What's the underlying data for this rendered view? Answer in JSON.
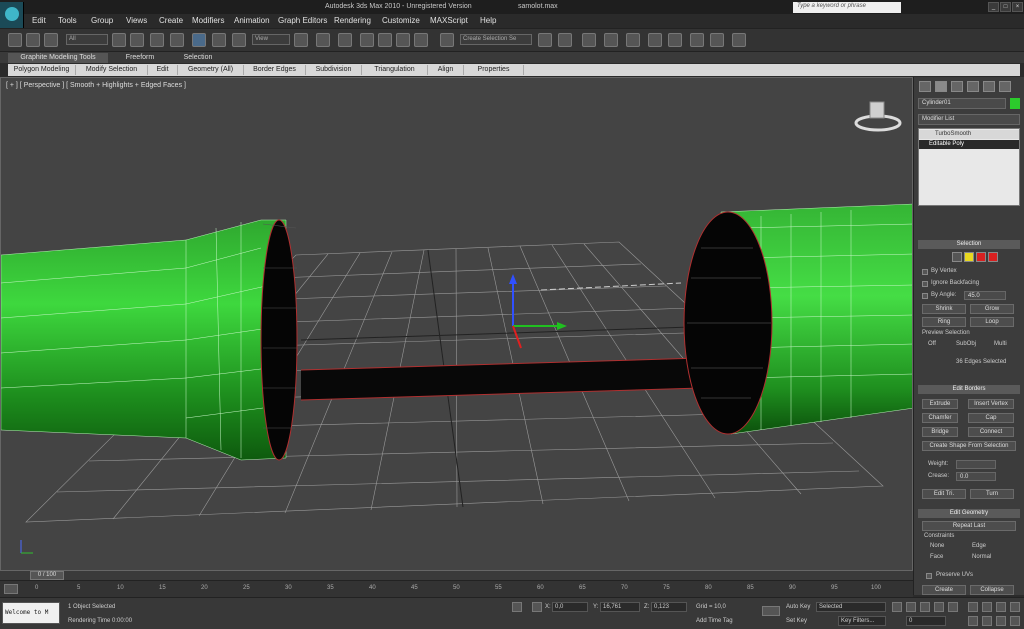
{
  "app": {
    "title": "Autodesk 3ds Max  2010  - Unregistered Version",
    "filename": "samolot.max",
    "search_placeholder": "Type a keyword or phrase"
  },
  "menu": [
    "Edit",
    "Tools",
    "Group",
    "Views",
    "Create",
    "Modifiers",
    "Animation",
    "Graph Editors",
    "Rendering",
    "Customize",
    "MAXScript",
    "Help"
  ],
  "toolbar": {
    "selection_filter": "All",
    "reference_coord": "View",
    "named_selection": "Create Selection Se"
  },
  "ribbon": {
    "tabs": [
      "Graphite Modeling Tools",
      "Freeform",
      "Selection"
    ],
    "active_tab": "Graphite Modeling Tools",
    "panels": [
      "Polygon Modeling",
      "Modify Selection",
      "Edit",
      "Geometry (All)",
      "Border Edges",
      "Subdivision",
      "Triangulation",
      "Align",
      "Properties"
    ]
  },
  "viewport": {
    "label": "[ + ] [ Perspective ] [ Smooth + Highlights + Edged Faces ]"
  },
  "command_panel": {
    "object_name": "Cylinder01",
    "modifier_list": "Modifier List",
    "stack": [
      "TurboSmooth",
      "Editable Poly"
    ],
    "selection": {
      "title": "Selection",
      "by_vertex": "By Vertex",
      "ignore_backfacing": "Ignore Backfacing",
      "by_angle": "By Angle:",
      "by_angle_value": "45.0",
      "shrink": "Shrink",
      "grow": "Grow",
      "ring": "Ring",
      "loop": "Loop",
      "preview_selection": "Preview Selection",
      "off": "Off",
      "subobj": "SubObj",
      "multi": "Multi",
      "status": "36 Edges Selected"
    },
    "edit_borders": {
      "title": "Edit Borders",
      "extrude": "Extrude",
      "insert_vertex": "Insert Vertex",
      "chamfer": "Chamfer",
      "cap": "Cap",
      "bridge": "Bridge",
      "connect": "Connect",
      "create_shape": "Create Shape From Selection",
      "weight": "Weight:",
      "crease": "Crease:",
      "crease_value": "0.0",
      "edit_tri": "Edit Tri.",
      "turn": "Turn"
    },
    "edit_geometry": {
      "title": "Edit Geometry",
      "repeat_last": "Repeat Last",
      "constraints": "Constraints",
      "none": "None",
      "edge": "Edge",
      "face": "Face",
      "normal": "Normal",
      "preserve_uvs": "Preserve UVs",
      "create": "Create",
      "collapse": "Collapse"
    }
  },
  "timeline": {
    "frame": "0 / 100",
    "ticks": [
      "0",
      "5",
      "10",
      "15",
      "20",
      "25",
      "30",
      "35",
      "40",
      "45",
      "50",
      "55",
      "60",
      "65",
      "70",
      "75",
      "80",
      "85",
      "90",
      "95",
      "100"
    ]
  },
  "status": {
    "welcome": "Welcome to M",
    "selected": "1 Object Selected",
    "rendering_time": "Rendering Time  0:00:00",
    "x": "0,0",
    "y": "16,761",
    "z": "0,123",
    "grid": "Grid = 10,0",
    "add_time_tag": "Add Time Tag",
    "auto_key": "Auto Key",
    "set_key": "Set Key",
    "key_mode": "Selected",
    "key_filters": "Key Filters...",
    "current_frame": "0"
  }
}
